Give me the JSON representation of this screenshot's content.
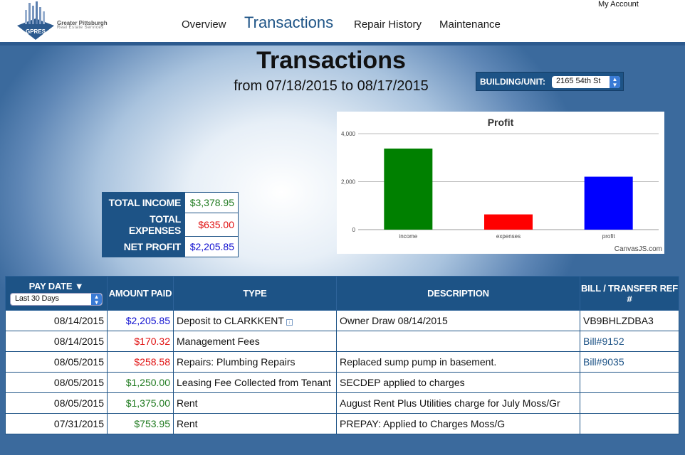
{
  "brand": {
    "name": "Greater Pittsburgh",
    "tagline": "Real Estate Services",
    "abbr": "GPRES"
  },
  "nav": {
    "overview": "Overview",
    "transactions": "Transactions",
    "repair_history": "Repair History",
    "maintenance": "Maintenance",
    "my_account": "My Account"
  },
  "page": {
    "title": "Transactions",
    "subtitle": "from 07/18/2015 to 08/17/2015"
  },
  "building": {
    "label": "BUILDING/UNIT:",
    "selected": "2165 54th St"
  },
  "totals": [
    {
      "label": "TOTAL INCOME",
      "value": "$3,378.95",
      "color": "#1f7a1f"
    },
    {
      "label": "TOTAL EXPENSES",
      "value": "$635.00",
      "color": "#e01010"
    },
    {
      "label": "NET PROFIT",
      "value": "$2,205.85",
      "color": "#1010d0"
    }
  ],
  "chart_data": {
    "type": "bar",
    "title": "Profit",
    "categories": [
      "income",
      "expenses",
      "profit"
    ],
    "values": [
      3378.95,
      635.0,
      2205.85
    ],
    "colors": [
      "#008000",
      "#ff0000",
      "#0000ff"
    ],
    "ylim": [
      0,
      4000
    ],
    "yticks": [
      "0",
      "2,000",
      "4,000"
    ],
    "grid": true,
    "credit": "CanvasJS.com"
  },
  "table": {
    "headers": {
      "pay_date": "PAY DATE ▼",
      "amount": "AMOUNT PAID",
      "type": "TYPE",
      "description": "DESCRIPTION",
      "ref": "BILL / TRANSFER REF #"
    },
    "date_filter": "Last 30 Days",
    "rows": [
      {
        "date": "08/14/2015",
        "amount": "$2,205.85",
        "amount_color": "blue",
        "type": "Deposit to CLARKKENT",
        "description": "Owner Draw 08/14/2015",
        "ref": "VB9BHLZDBA3",
        "ref_link": false
      },
      {
        "date": "08/14/2015",
        "amount": "$170.32",
        "amount_color": "red",
        "type": "Management Fees",
        "description": "",
        "ref": "Bill#9152",
        "ref_link": true
      },
      {
        "date": "08/05/2015",
        "amount": "$258.58",
        "amount_color": "red",
        "type": "Repairs: Plumbing Repairs",
        "description": "Replaced sump pump in basement.",
        "ref": "Bill#9035",
        "ref_link": true
      },
      {
        "date": "08/05/2015",
        "amount": "$1,250.00",
        "amount_color": "green",
        "type": "Leasing Fee Collected from Tenant",
        "description": "SECDEP applied to charges",
        "ref": "",
        "ref_link": false
      },
      {
        "date": "08/05/2015",
        "amount": "$1,375.00",
        "amount_color": "green",
        "type": "Rent",
        "description": "August Rent Plus Utilities charge for July Moss/Gr",
        "ref": "",
        "ref_link": false
      },
      {
        "date": "07/31/2015",
        "amount": "$753.95",
        "amount_color": "green",
        "type": "Rent",
        "description": "PREPAY: Applied to Charges Moss/G",
        "ref": "",
        "ref_link": false
      }
    ]
  }
}
